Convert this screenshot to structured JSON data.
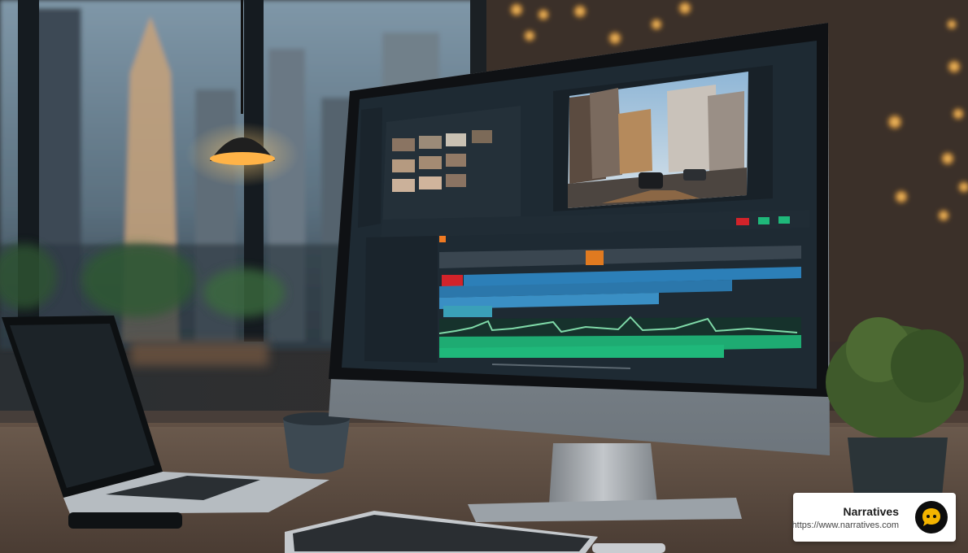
{
  "image": {
    "subject": "desktop-workspace",
    "colors": {
      "monitor_bezel": "#0f1114",
      "editor_bg": "#1e2a33",
      "clip_blue": "#2c7fb8",
      "clip_red": "#d2232a",
      "audio_green": "#1fb87a",
      "bokeh": "#f7b14a"
    }
  },
  "badge": {
    "title": "Narratives",
    "url": "https://www.narratives.com",
    "logo_icon": "chat-bubble-icon",
    "logo_color": "#f4b400"
  }
}
